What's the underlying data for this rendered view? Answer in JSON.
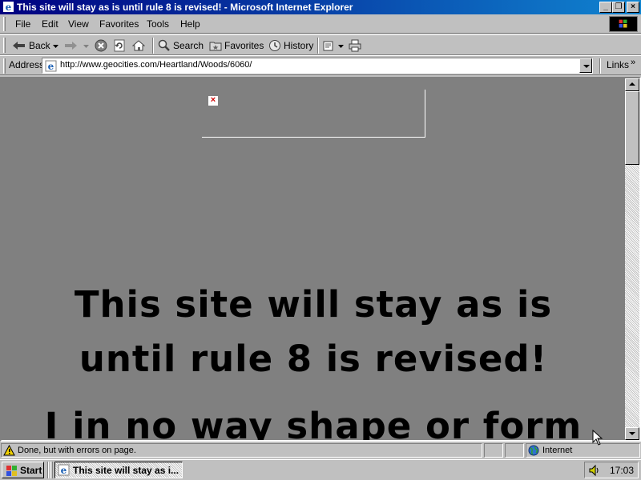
{
  "window": {
    "title": "This site will stay as is until rule 8 is revised! - Microsoft Internet Explorer",
    "controls": {
      "minimize": "_",
      "maximize": "❐",
      "close": "×"
    }
  },
  "menu": {
    "file": "File",
    "edit": "Edit",
    "view": "View",
    "favorites": "Favorites",
    "tools": "Tools",
    "help": "Help"
  },
  "toolbar": {
    "back": "Back",
    "search": "Search",
    "favorites": "Favorites",
    "history": "History"
  },
  "address": {
    "label": "Address",
    "url": "http://www.geocities.com/Heartland/Woods/6060/",
    "links_label": "Links",
    "links_chevron": "»"
  },
  "content": {
    "broken_image_mark": "×",
    "lines": [
      "This site will stay as is",
      "until rule 8 is revised!",
      "I in no way shape or form"
    ]
  },
  "status": {
    "text": "Done, but with errors on page.",
    "zone": "Internet"
  },
  "taskbar": {
    "start": "Start",
    "task_ie": "This site will stay as i...",
    "clock": "17:03"
  },
  "colors": {
    "titlebar_start": "#000080",
    "titlebar_end": "#1084d0",
    "chrome": "#c0c0c0",
    "content_background": "#808080",
    "headline_text": "#000000"
  },
  "icons": {
    "title": "ie-page-icon",
    "back": "back-arrow-icon",
    "forward": "forward-arrow-icon",
    "stop": "stop-icon",
    "refresh": "refresh-icon",
    "home": "home-icon",
    "search": "search-icon",
    "favorites": "favorites-folder-icon",
    "history": "history-icon",
    "mail": "mail-icon",
    "print": "print-icon",
    "status_warning": "warning-icon",
    "zone": "globe-icon",
    "start": "windows-logo-icon",
    "volume": "speaker-icon"
  }
}
